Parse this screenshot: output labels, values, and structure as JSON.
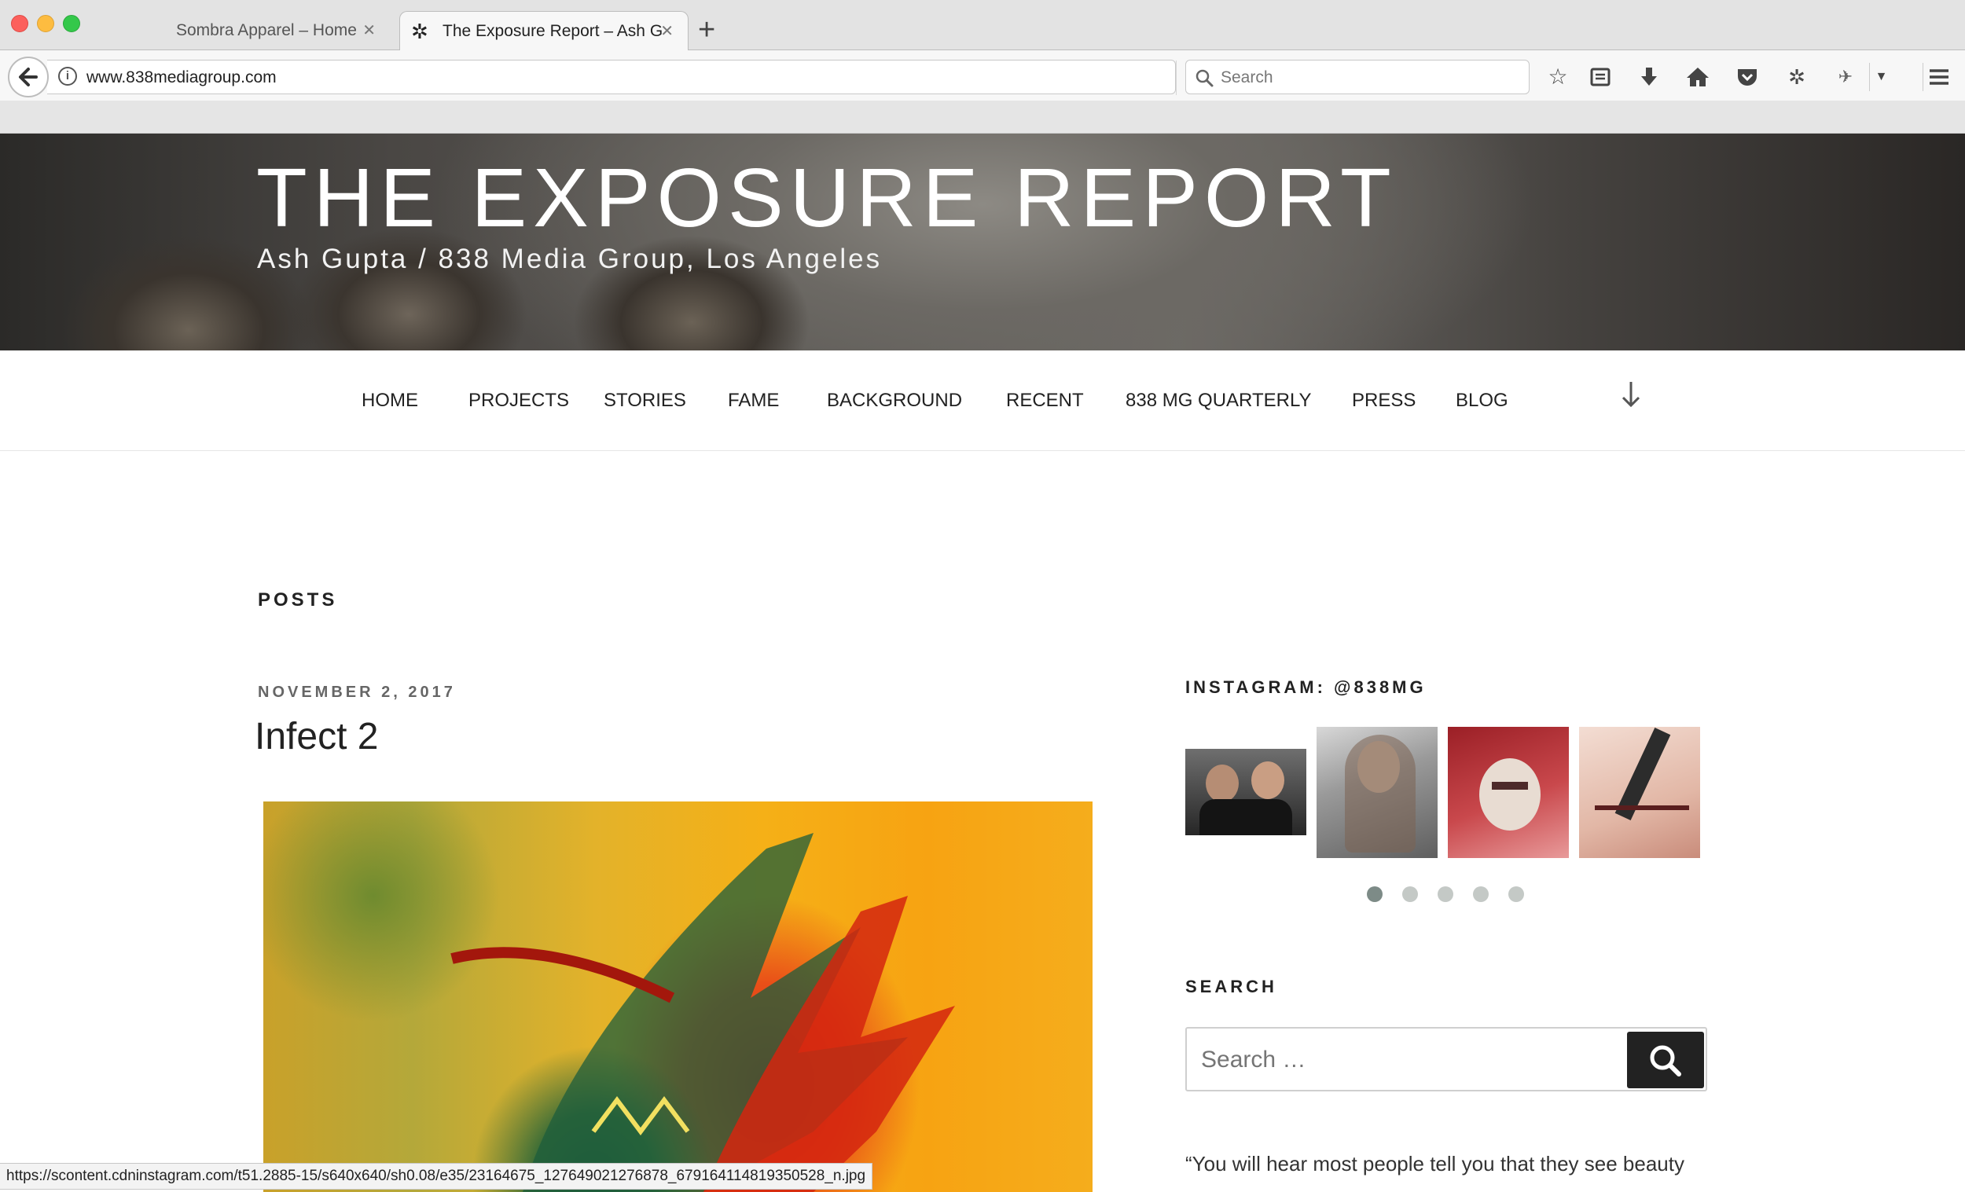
{
  "browser": {
    "tabs": [
      {
        "label": "Sombra Apparel – Home",
        "active": false
      },
      {
        "label": "The Exposure Report – Ash G",
        "active": true
      }
    ],
    "url": "www.838mediagroup.com",
    "search_placeholder": "Search",
    "status_url": "https://scontent.cdninstagram.com/t51.2885-15/s640x640/sh0.08/e35/23164675_127649021276878_679164114819350528_n.jpg"
  },
  "header": {
    "title": "THE EXPOSURE REPORT",
    "subtitle": "Ash Gupta / 838 Media Group, Los Angeles"
  },
  "nav": {
    "items": [
      "HOME",
      "PROJECTS",
      "STORIES",
      "FAME",
      "BACKGROUND",
      "RECENT",
      "838 MG QUARTERLY",
      "PRESS",
      "BLOG"
    ]
  },
  "main": {
    "section_title": "POSTS",
    "post": {
      "date": "NOVEMBER 2, 2017",
      "title": "Infect 2"
    }
  },
  "sidebar": {
    "instagram_title": "INSTAGRAM: @838MG",
    "carousel_pages": 5,
    "carousel_active": 1,
    "search_title": "SEARCH",
    "search_placeholder": "Search …",
    "quote": "“You will hear most people tell you that they see beauty"
  },
  "colors": {
    "nav_text": "#222222",
    "search_button": "#222222",
    "dot_active": "#7d8b87",
    "dot_inactive": "#c4c9c6"
  }
}
